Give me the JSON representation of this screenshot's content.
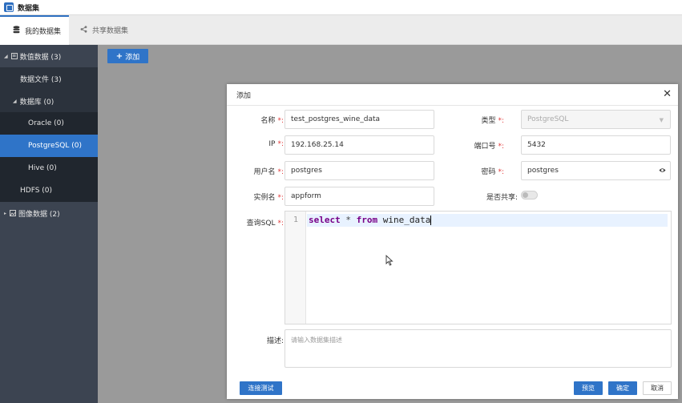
{
  "window": {
    "title": "数据集"
  },
  "tabs": [
    {
      "label": "我的数据集",
      "icon": "database-icon"
    },
    {
      "label": "共享数据集",
      "icon": "share-icon"
    }
  ],
  "sidebar": {
    "items": [
      {
        "label": "数值数据 (3)"
      },
      {
        "label": "数据文件 (3)"
      },
      {
        "label": "数据库 (0)"
      },
      {
        "label": "Oracle (0)"
      },
      {
        "label": "PostgreSQL (0)"
      },
      {
        "label": "Hive (0)"
      },
      {
        "label": "HDFS (0)"
      },
      {
        "label": "图像数据 (2)"
      }
    ]
  },
  "toolbar": {
    "add_label": "添加"
  },
  "dialog": {
    "title": "添加",
    "fields": {
      "name": {
        "label": "名称",
        "value": "test_postgres_wine_data"
      },
      "type": {
        "label": "类型",
        "value": "PostgreSQL"
      },
      "ip": {
        "label": "IP",
        "value": "192.168.25.14"
      },
      "port": {
        "label": "端口号",
        "value": "5432"
      },
      "username": {
        "label": "用户名",
        "value": "postgres"
      },
      "password": {
        "label": "密码",
        "value": "postgres"
      },
      "instance": {
        "label": "实例名",
        "value": "appform"
      },
      "shared": {
        "label": "是否共享",
        "value": false
      },
      "sql": {
        "label": "查询SQL",
        "line_number": "1",
        "kw_select": "select",
        "star": " * ",
        "kw_from": "from",
        "table": " wine_data"
      },
      "description": {
        "label": "描述",
        "placeholder": "请输入数据集描述"
      }
    },
    "buttons": {
      "test": "连接测试",
      "preview": "预览",
      "confirm": "确定",
      "cancel": "取消"
    }
  },
  "colors": {
    "accent": "#2f74c8",
    "sidebar_bg": "#3c4451",
    "required": "#e23a3a"
  }
}
